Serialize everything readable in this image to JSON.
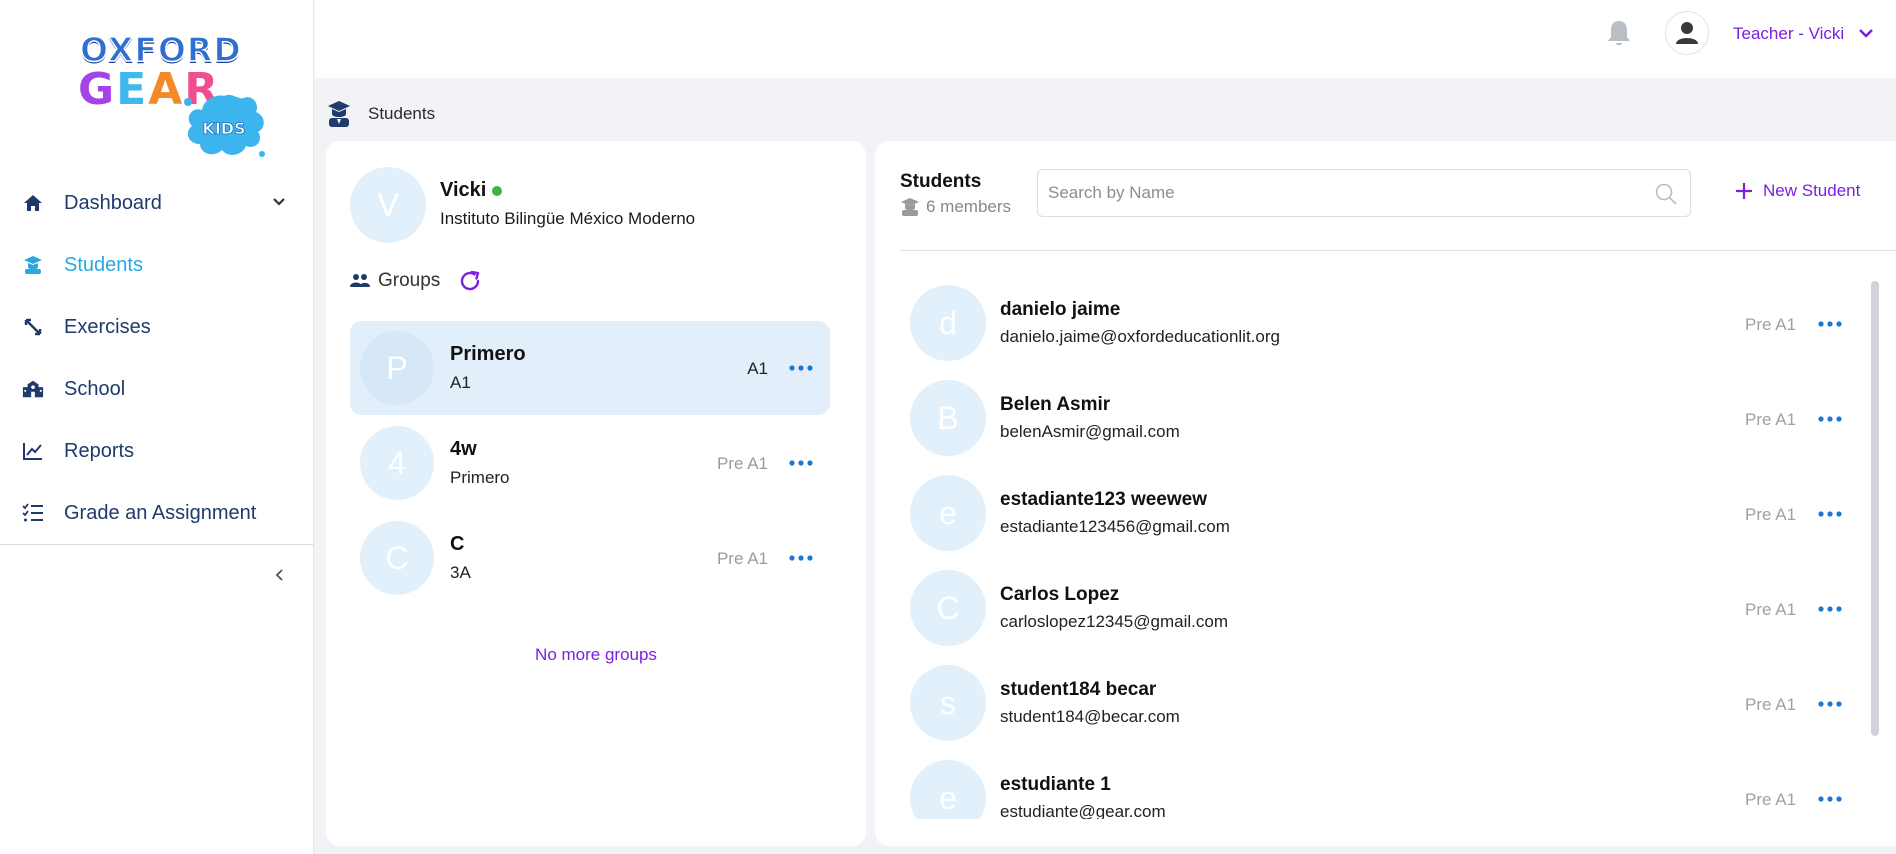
{
  "logo": {
    "line1": "OXFORD",
    "line2_letters": [
      "G",
      "E",
      "A",
      "R"
    ],
    "badge": "KIDS"
  },
  "sidebar": {
    "items": [
      {
        "label": "Dashboard",
        "icon": "home-icon",
        "has_chevron": true
      },
      {
        "label": "Students",
        "icon": "student-icon",
        "active": true
      },
      {
        "label": "Exercises",
        "icon": "exercises-icon"
      },
      {
        "label": "School",
        "icon": "school-icon"
      },
      {
        "label": "Reports",
        "icon": "reports-icon"
      },
      {
        "label": "Grade an Assignment",
        "icon": "checklist-icon"
      }
    ]
  },
  "topbar": {
    "user_label": "Teacher - Vicki"
  },
  "breadcrumb": {
    "label": "Students"
  },
  "teacher": {
    "initial": "V",
    "name": "Vicki",
    "school": "Instituto Bilingüe México Moderno",
    "online": true
  },
  "groups": {
    "heading": "Groups",
    "items": [
      {
        "initial": "P",
        "title": "Primero",
        "sub": "A1",
        "level": "A1",
        "selected": true
      },
      {
        "initial": "4",
        "title": "4w",
        "sub": "Primero",
        "level": "Pre A1",
        "selected": false
      },
      {
        "initial": "C",
        "title": "C",
        "sub": "3A",
        "level": "Pre A1",
        "selected": false
      }
    ],
    "end_text": "No more groups"
  },
  "students": {
    "title": "Students",
    "member_count": "6 members",
    "search_placeholder": "Search by Name",
    "new_button": "New Student",
    "items": [
      {
        "initial": "d",
        "name": "danielo jaime",
        "email": "danielo.jaime@oxfordeducationlit.org",
        "level": "Pre A1"
      },
      {
        "initial": "B",
        "name": "Belen Asmir",
        "email": "belenAsmir@gmail.com",
        "level": "Pre A1"
      },
      {
        "initial": "e",
        "name": "estadiante123 weewew",
        "email": "estadiante123456@gmail.com",
        "level": "Pre A1"
      },
      {
        "initial": "C",
        "name": "Carlos Lopez",
        "email": "carloslopez12345@gmail.com",
        "level": "Pre A1"
      },
      {
        "initial": "s",
        "name": "student184 becar",
        "email": "student184@becar.com",
        "level": "Pre A1"
      },
      {
        "initial": "e",
        "name": "estudiante 1",
        "email": "estudiante@gear.com",
        "level": "Pre A1"
      }
    ]
  },
  "colors": {
    "accent_purple": "#7b1fe0",
    "active_blue": "#29a8e0",
    "nav_text": "#1f3a6b",
    "avatar_bg": "#e2f0fb",
    "selected_row": "#e2eef9",
    "online_green": "#3bb54a"
  }
}
